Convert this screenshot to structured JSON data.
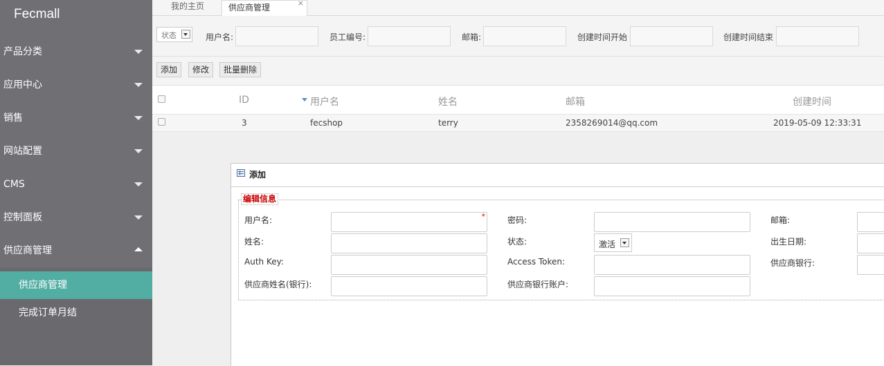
{
  "sidebar": {
    "brand": "Fecmall",
    "items": [
      {
        "label": "产品分类"
      },
      {
        "label": "应用中心"
      },
      {
        "label": "销售"
      },
      {
        "label": "网站配置"
      },
      {
        "label": "CMS"
      },
      {
        "label": "控制面板"
      },
      {
        "label": "供应商管理"
      }
    ],
    "subitems": [
      {
        "label": "供应商管理",
        "active": true
      },
      {
        "label": "完成订单月结"
      }
    ],
    "colors": {
      "bg": "#707074",
      "active": "#52aea3"
    }
  },
  "tabs": [
    {
      "label": "我的主页"
    },
    {
      "label": "供应商管理",
      "close": "×"
    }
  ],
  "filter": {
    "status_selected": "状态",
    "username_label": "用户名:",
    "employee_label": "员工编号:",
    "email_label": "邮箱:",
    "created_start_label": "创建时间开始",
    "created_end_label": "创建时间结束"
  },
  "toolbar": {
    "add_label": "添加",
    "edit_label": "修改",
    "batch_delete_label": "批量删除"
  },
  "grid": {
    "columns": [
      "ID",
      "用户名",
      "姓名",
      "邮箱",
      "创建时间"
    ],
    "rows": [
      {
        "id": "3",
        "username": "fecshop",
        "name": "terry",
        "email": "2358269014@qq.com",
        "created": "2019-05-09 12:33:31"
      }
    ]
  },
  "dialog": {
    "title": "添加",
    "legend": "编辑信息",
    "labels": {
      "username": "用户名:",
      "password": "密码:",
      "email": "邮箱:",
      "name": "姓名:",
      "status": "状态:",
      "birthday": "出生日期:",
      "auth_key": "Auth Key:",
      "access_token": "Access Token:",
      "supplier_bank": "供应商银行:",
      "bank_name": "供应商姓名(银行):",
      "bank_account": "供应商银行账户:"
    },
    "status_value": "激活",
    "required_mark": "*"
  }
}
